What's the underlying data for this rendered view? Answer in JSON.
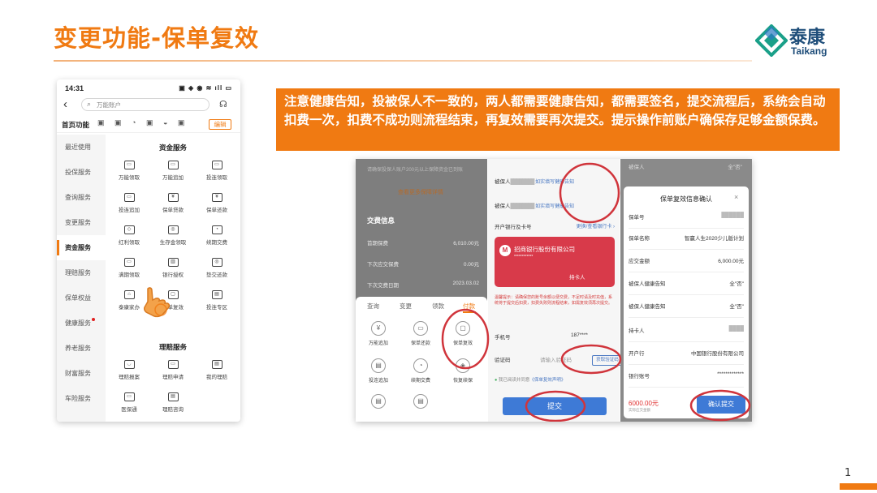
{
  "slide": {
    "title": "变更功能-保单复效",
    "logo_cn": "泰康",
    "logo_en": "Taikang",
    "page_number": "1",
    "notice": "注意健康告知，投被保人不一致的，两人都需要健康告知，都需要签名，提交流程后，系统会自动扣费一次，扣费不成功则流程结束，再复效需要再次提交。提示操作前账户确保存足够金额保费。"
  },
  "phone1": {
    "time": "14:31",
    "status_icons": "▣ ◈ ◉ ≋ ıll ▭",
    "search_placeholder": "万能账户",
    "home_func_label": "首页功能",
    "home_func_icons": "▣ ▣ ◔ ▣ ◒ ▣",
    "edit_label": "编辑",
    "sidebar": [
      {
        "label": "最近使用"
      },
      {
        "label": "投保服务"
      },
      {
        "label": "查询服务"
      },
      {
        "label": "变更服务"
      },
      {
        "label": "资金服务",
        "active": true
      },
      {
        "label": "理赔服务"
      },
      {
        "label": "保单权益"
      },
      {
        "label": "健康服务",
        "badge": true
      },
      {
        "label": "养老服务"
      },
      {
        "label": "财富服务"
      },
      {
        "label": "车险服务"
      }
    ],
    "section_fund": "资金服务",
    "fund_items": [
      {
        "label": "万能领取",
        "icon": "▭"
      },
      {
        "label": "万能追加",
        "icon": "▭"
      },
      {
        "label": "投连领取",
        "icon": "▭"
      },
      {
        "label": "投连追加",
        "icon": "▭"
      },
      {
        "label": "保单贷款",
        "icon": "¥"
      },
      {
        "label": "保单还款",
        "icon": "¥"
      },
      {
        "label": "红利领取",
        "icon": "◇"
      },
      {
        "label": "生存金领取",
        "icon": "◎"
      },
      {
        "label": "续期交费",
        "icon": "◔"
      },
      {
        "label": "满期领取",
        "icon": "▭"
      },
      {
        "label": "银行授权",
        "icon": "▥"
      },
      {
        "label": "垫交还款",
        "icon": "◎"
      },
      {
        "label": "泰康家办",
        "icon": "⌂"
      },
      {
        "label": "保单复效",
        "icon": "▢"
      },
      {
        "label": "投连专区",
        "icon": "▤"
      }
    ],
    "section_claim": "理赔服务",
    "claim_items": [
      {
        "label": "理赔报案",
        "icon": "◡"
      },
      {
        "label": "理赔申请",
        "icon": "▭"
      },
      {
        "label": "我的理赔",
        "icon": "▤"
      },
      {
        "label": "医保通",
        "icon": "▭"
      },
      {
        "label": "理赔咨询",
        "icon": "▤"
      }
    ]
  },
  "phone2a": {
    "top_text": "请确保投保人账户200元以上保障资金已到账",
    "orange_text": "查看更多保障详情",
    "info_title": "交费信息",
    "rows": [
      {
        "k": "首期保费",
        "v": "6,010.00元"
      },
      {
        "k": "下次应交保费",
        "v": "0.00元"
      },
      {
        "k": "下次交费日期",
        "v": "2023.03.02"
      }
    ],
    "tabs": [
      "查询",
      "变更",
      "领款",
      "付款"
    ],
    "grid": [
      {
        "label": "万能追加",
        "icon": "¥"
      },
      {
        "label": "保单还款",
        "icon": "▭"
      },
      {
        "label": "保单复效",
        "icon": "▢"
      },
      {
        "label": "投连追加",
        "icon": "▤"
      },
      {
        "label": "续期交费",
        "icon": "◔"
      },
      {
        "label": "恢复续保",
        "icon": "◈"
      },
      {
        "label": "",
        "icon": "▤"
      },
      {
        "label": "",
        "icon": "▤"
      }
    ]
  },
  "phone2b": {
    "insured1_label": "被保人",
    "insured1_blur": "████████",
    "insured1_link": "如实填写健康告知",
    "insured2_label": "被保人",
    "insured2_blur": "████████",
    "insured2_link": "如实填写健康告知",
    "bank_label": "开户银行及卡号",
    "bank_link": "更换/查看银行卡 ›",
    "bank_name": "招商银行股份有限公司",
    "bank_no": "************",
    "holder": "持卡人",
    "warning": "温馨提示：请确保您的账号余额以便交费，不足时请及时充值，系统将于提交后扣费，扣费失败则流程结束，如需复效须再次提交。",
    "phone_label": "手机号",
    "phone_value": "187****",
    "code_label": "验证码",
    "code_placeholder": "请输入验证码",
    "code_button": "获取验证码",
    "agree_prefix": "我已阅读并同意",
    "agree_link": "《保单复效声明》",
    "submit": "提交"
  },
  "phone2c": {
    "bg_label": "被保人",
    "bg_value": "全\"否\"",
    "modal_title": "保单复效信息确认",
    "close": "×",
    "rows": [
      {
        "k": "保单号",
        "v": "██████",
        "blur": true
      },
      {
        "k": "保单名称",
        "v": "智赢人生2020少儿版计划"
      },
      {
        "k": "应交金额",
        "v": "6,000.00元"
      },
      {
        "k": "被保人健康告知",
        "v": "全\"否\""
      },
      {
        "k": "被保人健康告知",
        "v": "全\"否\""
      },
      {
        "k": "持卡人",
        "v": "████",
        "blur": true
      },
      {
        "k": "开户行",
        "v": "中国银行股份有限公司"
      },
      {
        "k": "银行账号",
        "v": "*************",
        "blur": false
      }
    ],
    "total": "6000.00元",
    "total_sub": "实际应交金额",
    "confirm": "确认提交"
  },
  "colors": {
    "accent": "#f07a12",
    "callout": "#d0343b",
    "brand": "#1f4e7a",
    "button": "#3e7ad6"
  }
}
